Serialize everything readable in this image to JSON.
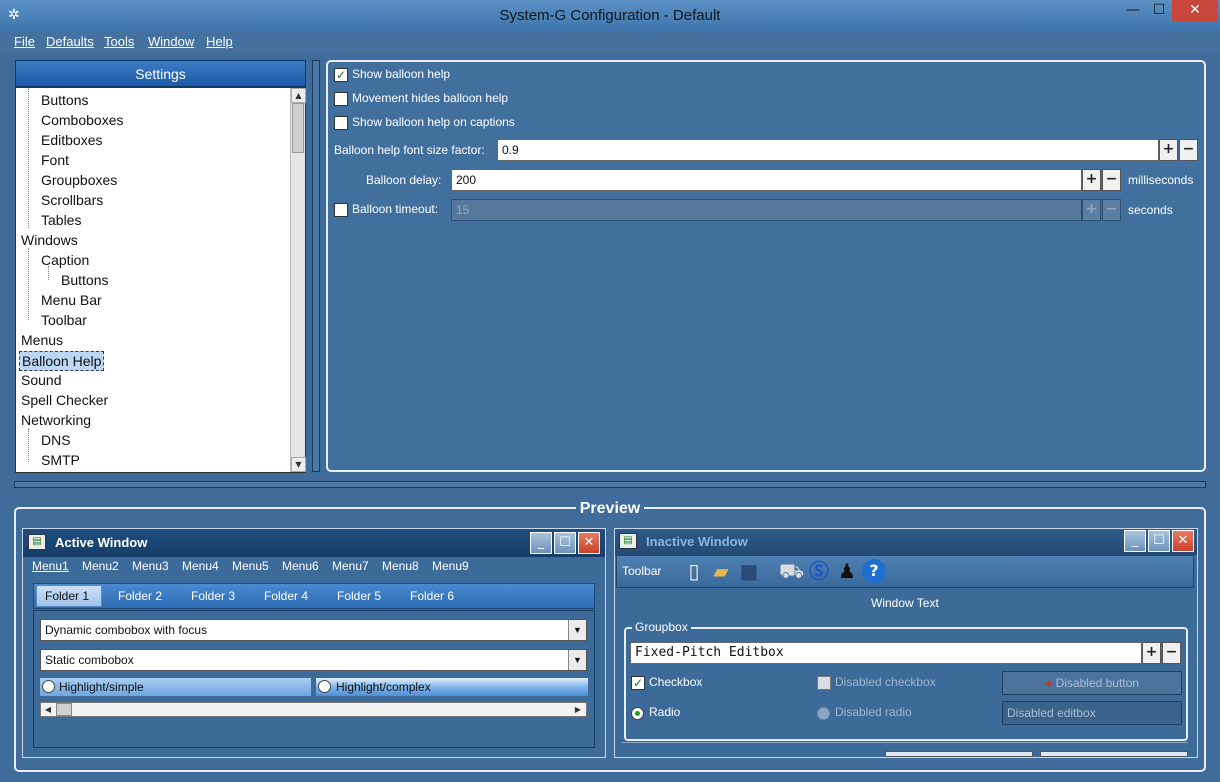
{
  "window": {
    "title": "System-G Configuration - Default"
  },
  "menubar": [
    "File",
    "Defaults",
    "Tools",
    "Window",
    "Help"
  ],
  "settings": {
    "header": "Settings",
    "tree": [
      "Buttons",
      "Comboboxes",
      "Editboxes",
      "Font",
      "Groupboxes",
      "Scrollbars",
      "Tables",
      "Windows",
      "Caption",
      "Buttons",
      "Menu Bar",
      "Toolbar",
      "Menus",
      "Balloon Help",
      "Sound",
      "Spell Checker",
      "Networking",
      "DNS",
      "SMTP"
    ],
    "selected": "Balloon Help"
  },
  "balloon": {
    "show_help": {
      "label": "Show balloon help",
      "checked": true
    },
    "movement_hides": {
      "label": "Movement hides balloon help",
      "checked": false
    },
    "show_on_captions": {
      "label": "Show balloon help on captions",
      "checked": false
    },
    "font_size_label": "Balloon help font size factor:",
    "font_size_value": "0.9",
    "delay_label": "Balloon delay:",
    "delay_value": "200",
    "delay_unit": "milliseconds",
    "timeout_label": "Balloon timeout:",
    "timeout_value": "15",
    "timeout_unit": "seconds",
    "timeout_checked": false
  },
  "preview": {
    "label": "Preview",
    "active": {
      "title": "Active Window",
      "menus": [
        "Menu1",
        "Menu2",
        "Menu3",
        "Menu4",
        "Menu5",
        "Menu6",
        "Menu7",
        "Menu8",
        "Menu9"
      ],
      "tabs": [
        "Folder 1",
        "Folder 2",
        "Folder 3",
        "Folder 4",
        "Folder 5",
        "Folder 6"
      ],
      "combo1": "Dynamic combobox with focus",
      "combo2": "Static combobox",
      "radio1": "Highlight/simple",
      "radio2": "Highlight/complex"
    },
    "inactive": {
      "title": "Inactive Window",
      "toolbar_label": "Toolbar",
      "window_text": "Window Text",
      "groupbox_label": "Groupbox",
      "editbox": "Fixed-Pitch Editbox",
      "checkbox": "Checkbox",
      "disabled_checkbox": "Disabled checkbox",
      "disabled_button": "Disabled button",
      "radio": "Radio",
      "disabled_radio": "Disabled radio",
      "disabled_editbox": "Disabled editbox"
    }
  },
  "icons": [
    "new-document-icon",
    "open-folder-icon",
    "save-icon",
    "cart-icon",
    "s-logo-icon",
    "joystick-icon",
    "help-icon"
  ]
}
